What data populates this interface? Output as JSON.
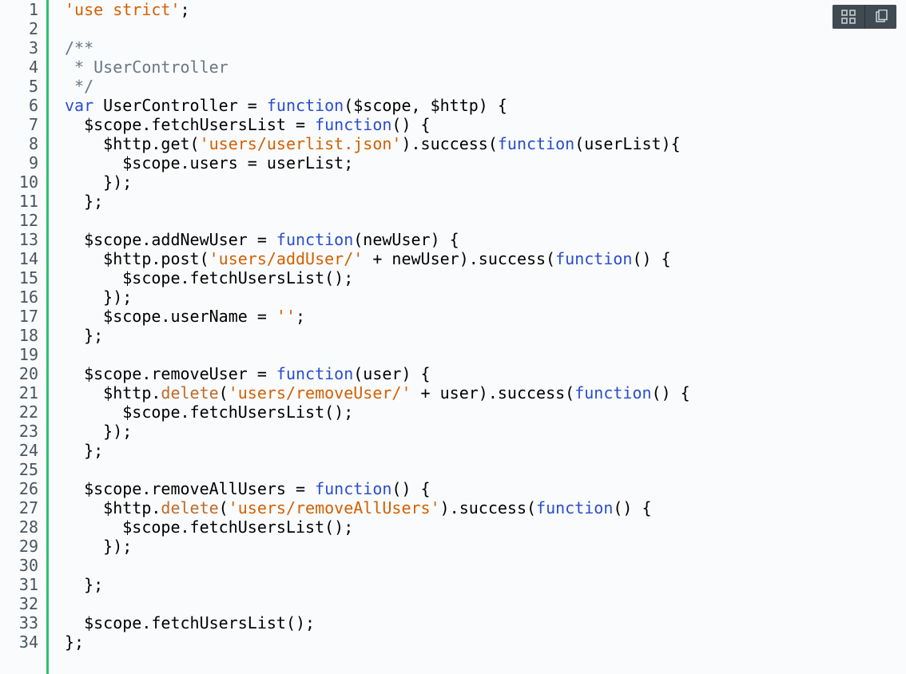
{
  "colors": {
    "background": "#f9fbfc",
    "gutter_text": "#4a5560",
    "change_bar": "#2fbf71",
    "toolbar_bg": "#3f4a52",
    "keyword": "#2a4dcf",
    "string": "#d45f00",
    "comment": "#6a7785",
    "method_delete": "#c06a28",
    "plain": "#000000"
  },
  "toolbar": {
    "grid_button_label": "Toggle grid",
    "copy_button_label": "Copy"
  },
  "line_count": 34,
  "code_lines": [
    [
      [
        "str",
        "'use strict'"
      ],
      [
        "pl",
        ";"
      ]
    ],
    [
      [
        "pl",
        ""
      ]
    ],
    [
      [
        "com",
        "/**"
      ]
    ],
    [
      [
        "com",
        " * UserController"
      ]
    ],
    [
      [
        "com",
        " */"
      ]
    ],
    [
      [
        "key",
        "var"
      ],
      [
        "pl",
        " UserController = "
      ],
      [
        "key",
        "function"
      ],
      [
        "pl",
        "($scope, $http) {"
      ]
    ],
    [
      [
        "pl",
        "  $scope.fetchUsersList = "
      ],
      [
        "key",
        "function"
      ],
      [
        "pl",
        "() {"
      ]
    ],
    [
      [
        "pl",
        "    $http.get("
      ],
      [
        "str",
        "'users/userlist.json'"
      ],
      [
        "pl",
        ").success("
      ],
      [
        "key",
        "function"
      ],
      [
        "pl",
        "(userList){"
      ]
    ],
    [
      [
        "pl",
        "      $scope.users = userList;"
      ]
    ],
    [
      [
        "pl",
        "    });"
      ]
    ],
    [
      [
        "pl",
        "  };"
      ]
    ],
    [
      [
        "pl",
        ""
      ]
    ],
    [
      [
        "pl",
        "  $scope.addNewUser = "
      ],
      [
        "key",
        "function"
      ],
      [
        "pl",
        "(newUser) {"
      ]
    ],
    [
      [
        "pl",
        "    $http.post("
      ],
      [
        "str",
        "'users/addUser/'"
      ],
      [
        "pl",
        " + newUser).success("
      ],
      [
        "key",
        "function"
      ],
      [
        "pl",
        "() {"
      ]
    ],
    [
      [
        "pl",
        "      $scope.fetchUsersList();"
      ]
    ],
    [
      [
        "pl",
        "    });"
      ]
    ],
    [
      [
        "pl",
        "    $scope.userName = "
      ],
      [
        "str",
        "''"
      ],
      [
        "pl",
        ";"
      ]
    ],
    [
      [
        "pl",
        "  };"
      ]
    ],
    [
      [
        "pl",
        ""
      ]
    ],
    [
      [
        "pl",
        "  $scope.removeUser = "
      ],
      [
        "key",
        "function"
      ],
      [
        "pl",
        "(user) {"
      ]
    ],
    [
      [
        "pl",
        "    $http."
      ],
      [
        "fn",
        "delete"
      ],
      [
        "pl",
        "("
      ],
      [
        "str",
        "'users/removeUser/'"
      ],
      [
        "pl",
        " + user).success("
      ],
      [
        "key",
        "function"
      ],
      [
        "pl",
        "() {"
      ]
    ],
    [
      [
        "pl",
        "      $scope.fetchUsersList();"
      ]
    ],
    [
      [
        "pl",
        "    });"
      ]
    ],
    [
      [
        "pl",
        "  };"
      ]
    ],
    [
      [
        "pl",
        ""
      ]
    ],
    [
      [
        "pl",
        "  $scope.removeAllUsers = "
      ],
      [
        "key",
        "function"
      ],
      [
        "pl",
        "() {"
      ]
    ],
    [
      [
        "pl",
        "    $http."
      ],
      [
        "fn",
        "delete"
      ],
      [
        "pl",
        "("
      ],
      [
        "str",
        "'users/removeAllUsers'"
      ],
      [
        "pl",
        ").success("
      ],
      [
        "key",
        "function"
      ],
      [
        "pl",
        "() {"
      ]
    ],
    [
      [
        "pl",
        "      $scope.fetchUsersList();"
      ]
    ],
    [
      [
        "pl",
        "    });"
      ]
    ],
    [
      [
        "pl",
        ""
      ]
    ],
    [
      [
        "pl",
        "  };"
      ]
    ],
    [
      [
        "pl",
        ""
      ]
    ],
    [
      [
        "pl",
        "  $scope.fetchUsersList();"
      ]
    ],
    [
      [
        "pl",
        "};"
      ]
    ]
  ]
}
